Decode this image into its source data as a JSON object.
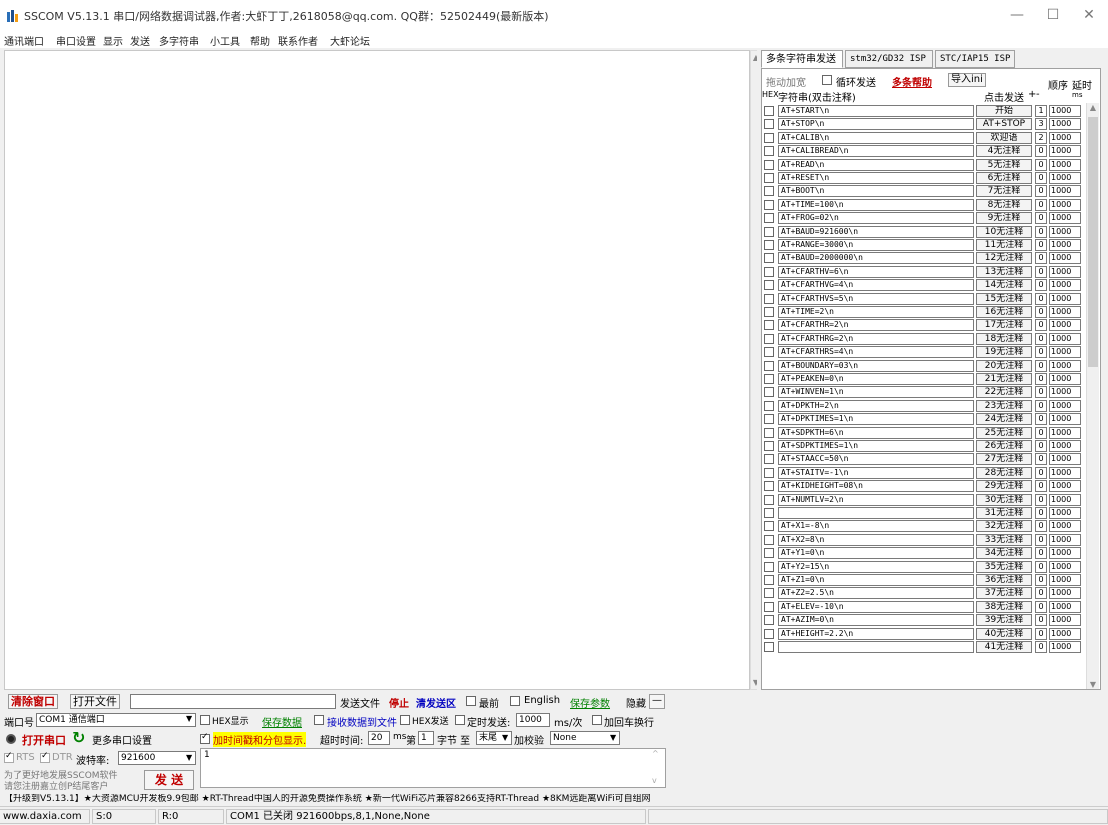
{
  "window": {
    "title": "SSCOM V5.13.1 串口/网络数据调试器,作者:大虾丁丁,2618058@qq.com. QQ群：52502449(最新版本)",
    "minimize": "—",
    "maximize": "☐",
    "close": "✕"
  },
  "menu": [
    "通讯端口",
    "串口设置",
    "显示",
    "发送",
    "多字符串",
    "小工具",
    "帮助",
    "联系作者",
    "大虾论坛"
  ],
  "multi": {
    "tabs": [
      "多条字符串发送",
      "stm32/GD32 ISP",
      "STC/IAP15 ISP"
    ],
    "drag_label": "拖动加宽",
    "loop_label": "循环发送",
    "help_label": "多条帮助",
    "import_label": "导入ini",
    "order_header": "顺序",
    "delay_header": "延时",
    "hex_header": "HEX",
    "str_header": "字符串(双击注释)",
    "click_send_header": "点击发送",
    "plus": "+",
    "minus": "-",
    "ms_header": "ms",
    "rows": [
      {
        "cmd": "AT+START\\n",
        "note": "开始",
        "order": "1",
        "delay": "1000"
      },
      {
        "cmd": "AT+STOP\\n",
        "note": "AT+STOP",
        "order": "3",
        "delay": "1000"
      },
      {
        "cmd": "AT+CALIB\\n",
        "note": "欢迎语",
        "order": "2",
        "delay": "1000"
      },
      {
        "cmd": "AT+CALIBREAD\\n",
        "note": "4无注释",
        "order": "0",
        "delay": "1000"
      },
      {
        "cmd": "AT+READ\\n",
        "note": "5无注释",
        "order": "0",
        "delay": "1000"
      },
      {
        "cmd": "AT+RESET\\n",
        "note": "6无注释",
        "order": "0",
        "delay": "1000"
      },
      {
        "cmd": "AT+BOOT\\n",
        "note": "7无注释",
        "order": "0",
        "delay": "1000"
      },
      {
        "cmd": "AT+TIME=100\\n",
        "note": "8无注释",
        "order": "0",
        "delay": "1000"
      },
      {
        "cmd": "AT+FROG=02\\n",
        "note": "9无注释",
        "order": "0",
        "delay": "1000"
      },
      {
        "cmd": "AT+BAUD=921600\\n",
        "note": "10无注释",
        "order": "0",
        "delay": "1000"
      },
      {
        "cmd": "AT+RANGE=3000\\n",
        "note": "11无注释",
        "order": "0",
        "delay": "1000"
      },
      {
        "cmd": "AT+BAUD=2000000\\n",
        "note": "12无注释",
        "order": "0",
        "delay": "1000"
      },
      {
        "cmd": "AT+CFARTHV=6\\n",
        "note": "13无注释",
        "order": "0",
        "delay": "1000"
      },
      {
        "cmd": "AT+CFARTHVG=4\\n",
        "note": "14无注释",
        "order": "0",
        "delay": "1000"
      },
      {
        "cmd": "AT+CFARTHVS=5\\n",
        "note": "15无注释",
        "order": "0",
        "delay": "1000"
      },
      {
        "cmd": "AT+TIME=2\\n",
        "note": "16无注释",
        "order": "0",
        "delay": "1000"
      },
      {
        "cmd": "AT+CFARTHR=2\\n",
        "note": "17无注释",
        "order": "0",
        "delay": "1000"
      },
      {
        "cmd": "AT+CFARTHRG=2\\n",
        "note": "18无注释",
        "order": "0",
        "delay": "1000"
      },
      {
        "cmd": "AT+CFARTHRS=4\\n",
        "note": "19无注释",
        "order": "0",
        "delay": "1000"
      },
      {
        "cmd": "AT+BOUNDARY=03\\n",
        "note": "20无注释",
        "order": "0",
        "delay": "1000"
      },
      {
        "cmd": "AT+PEAKEN=0\\n",
        "note": "21无注释",
        "order": "0",
        "delay": "1000"
      },
      {
        "cmd": "AT+WINVEN=1\\n",
        "note": "22无注释",
        "order": "0",
        "delay": "1000"
      },
      {
        "cmd": "AT+DPKTH=2\\n",
        "note": "23无注释",
        "order": "0",
        "delay": "1000"
      },
      {
        "cmd": "AT+DPKTIMES=1\\n",
        "note": "24无注释",
        "order": "0",
        "delay": "1000"
      },
      {
        "cmd": "AT+SDPKTH=6\\n",
        "note": "25无注释",
        "order": "0",
        "delay": "1000"
      },
      {
        "cmd": "AT+SDPKTIMES=1\\n",
        "note": "26无注释",
        "order": "0",
        "delay": "1000"
      },
      {
        "cmd": "AT+STAACC=50\\n",
        "note": "27无注释",
        "order": "0",
        "delay": "1000"
      },
      {
        "cmd": "AT+STAITV=-1\\n",
        "note": "28无注释",
        "order": "0",
        "delay": "1000"
      },
      {
        "cmd": "AT+KIDHEIGHT=08\\n",
        "note": "29无注释",
        "order": "0",
        "delay": "1000"
      },
      {
        "cmd": "AT+NUMTLV=2\\n",
        "note": "30无注释",
        "order": "0",
        "delay": "1000"
      },
      {
        "cmd": "",
        "note": "31无注释",
        "order": "0",
        "delay": "1000"
      },
      {
        "cmd": "AT+X1=-8\\n",
        "note": "32无注释",
        "order": "0",
        "delay": "1000"
      },
      {
        "cmd": "AT+X2=8\\n",
        "note": "33无注释",
        "order": "0",
        "delay": "1000"
      },
      {
        "cmd": "AT+Y1=0\\n",
        "note": "34无注释",
        "order": "0",
        "delay": "1000"
      },
      {
        "cmd": "AT+Y2=15\\n",
        "note": "35无注释",
        "order": "0",
        "delay": "1000"
      },
      {
        "cmd": "AT+Z1=0\\n",
        "note": "36无注释",
        "order": "0",
        "delay": "1000"
      },
      {
        "cmd": "AT+Z2=2.5\\n",
        "note": "37无注释",
        "order": "0",
        "delay": "1000"
      },
      {
        "cmd": "AT+ELEV=-10\\n",
        "note": "38无注释",
        "order": "0",
        "delay": "1000"
      },
      {
        "cmd": "AT+AZIM=0\\n",
        "note": "39无注释",
        "order": "0",
        "delay": "1000"
      },
      {
        "cmd": "AT+HEIGHT=2.2\\n",
        "note": "40无注释",
        "order": "0",
        "delay": "1000"
      },
      {
        "cmd": "",
        "note": "41无注释",
        "order": "0",
        "delay": "1000"
      }
    ]
  },
  "toolbar1": {
    "clear": "清除窗口",
    "open_file": "打开文件",
    "send_file": "发送文件",
    "stop": "停止",
    "clear_send": "清发送区",
    "topmost": "最前",
    "english": "English",
    "save_params": "保存参数",
    "hide": "隐藏",
    "collapse": "—"
  },
  "toolbar2": {
    "port_label": "端口号",
    "port_value": "COM1 通信端口",
    "hex_display": "HEX显示",
    "save_data": "保存数据",
    "recv_to_file": "接收数据到文件",
    "hex_send": "HEX发送",
    "timed_send": "定时发送:",
    "timed_value": "1000",
    "timed_unit": "ms/次",
    "add_crlf": "加回车换行"
  },
  "toolbar3": {
    "open_port": "打开串口",
    "more_settings": "更多串口设置",
    "timestamp": "加时间戳和分包显示.",
    "timeout_label": "超时时间:",
    "timeout_value": "20",
    "timeout_unit": "ms",
    "byte_label": "第",
    "byte_value": "1",
    "byte_unit": "字节 至",
    "end_value": "末尾",
    "checksum_label": "加校验",
    "checksum_value": "None"
  },
  "toolbar4": {
    "rts": "RTS",
    "dtr": "DTR",
    "baud_label": "波特率:",
    "baud_value": "921600",
    "send_text": "1"
  },
  "promo": {
    "line1": "为了更好地发展SSCOM软件",
    "line2": "请您注册嘉立创P结尾客户",
    "send_button": "发 送"
  },
  "ticker": "【升级到V5.13.1】★大资源MCU开发板9.9包邮 ★RT-Thread中国人的开源免费操作系统 ★新一代WiFi芯片兼容8266支持RT-Thread ★8KM远距离WiFi可自组网",
  "status": {
    "site": "www.daxia.com",
    "s": "S:0",
    "r": "R:0",
    "port_status": "COM1 已关闭  921600bps,8,1,None,None"
  },
  "colors": {
    "accent_red": "#c00000",
    "accent_blue": "#0000c0",
    "highlight_yellow": "#ffff00"
  }
}
